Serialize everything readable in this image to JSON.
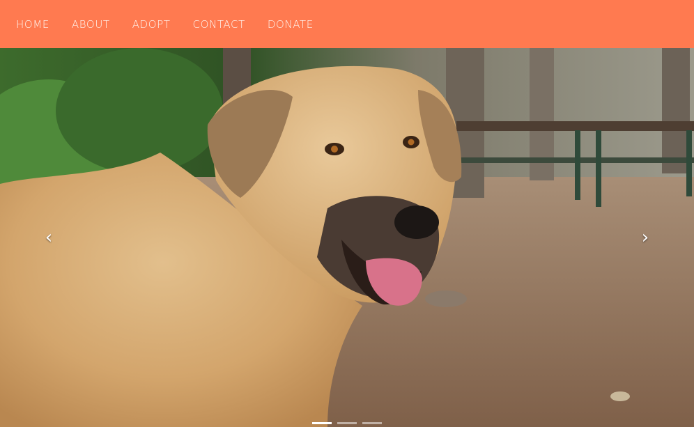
{
  "nav": {
    "items": [
      {
        "label": "HOME"
      },
      {
        "label": "ABOUT"
      },
      {
        "label": "ADOPT"
      },
      {
        "label": "CONTACT"
      },
      {
        "label": "DONATE"
      }
    ],
    "background": "#ff7a50",
    "text_color": "#fff5ef"
  },
  "carousel": {
    "prev_icon": "chevron-left-icon",
    "prev_glyph": "‹",
    "next_icon": "chevron-right-icon",
    "next_glyph": "›",
    "slide_count": 3,
    "active_slide": 1
  }
}
